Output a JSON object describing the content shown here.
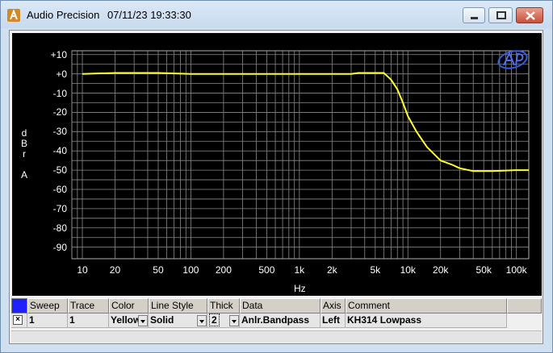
{
  "window": {
    "app_name": "Audio Precision",
    "datetime": "07/11/23 19:33:30"
  },
  "chart_data": {
    "type": "line",
    "xlabel": "Hz",
    "ylabel_letters": [
      "d",
      "B",
      "r",
      "",
      "A"
    ],
    "xscale": "log",
    "xlim": [
      8,
      130000
    ],
    "ylim": [
      -96,
      12
    ],
    "x_ticks": [
      {
        "v": 10,
        "label": "10"
      },
      {
        "v": 20,
        "label": "20"
      },
      {
        "v": 50,
        "label": "50"
      },
      {
        "v": 100,
        "label": "100"
      },
      {
        "v": 200,
        "label": "200"
      },
      {
        "v": 500,
        "label": "500"
      },
      {
        "v": 1000,
        "label": "1k"
      },
      {
        "v": 2000,
        "label": "2k"
      },
      {
        "v": 5000,
        "label": "5k"
      },
      {
        "v": 10000,
        "label": "10k"
      },
      {
        "v": 20000,
        "label": "20k"
      },
      {
        "v": 50000,
        "label": "50k"
      },
      {
        "v": 100000,
        "label": "100k"
      }
    ],
    "y_ticks": [
      {
        "v": 10,
        "label": "+10"
      },
      {
        "v": 0,
        "label": "+0"
      },
      {
        "v": -10,
        "label": "-10"
      },
      {
        "v": -20,
        "label": "-20"
      },
      {
        "v": -30,
        "label": "-30"
      },
      {
        "v": -40,
        "label": "-40"
      },
      {
        "v": -50,
        "label": "-50"
      },
      {
        "v": -60,
        "label": "-60"
      },
      {
        "v": -70,
        "label": "-70"
      },
      {
        "v": -80,
        "label": "-80"
      },
      {
        "v": -90,
        "label": "-90"
      }
    ],
    "grid": true,
    "series": [
      {
        "color": "#ffff33",
        "x": [
          10,
          20,
          50,
          100,
          200,
          500,
          1000,
          2000,
          3000,
          3500,
          5000,
          6000,
          7000,
          8000,
          9000,
          10000,
          12000,
          15000,
          20000,
          25000,
          30000,
          40000,
          50000,
          60000,
          100000,
          130000
        ],
        "y": [
          0,
          0.5,
          0.5,
          0,
          0,
          0,
          0,
          0,
          0,
          0.5,
          0.5,
          0.5,
          -3,
          -8,
          -15,
          -22,
          -30,
          -38,
          -45,
          -47,
          -49,
          -50.5,
          -50.5,
          -50.5,
          -50,
          -50
        ]
      }
    ]
  },
  "table": {
    "headers": [
      "Sweep",
      "Trace",
      "Color",
      "Line Style",
      "Thick",
      "Data",
      "Axis",
      "Comment"
    ],
    "row": {
      "checked": "×",
      "sweep": "1",
      "trace": "1",
      "color": "Yellow",
      "line_style": "Solid",
      "thick": "2",
      "data": "Anlr.Bandpass",
      "axis": "Left",
      "comment": "KH314 Lowpass"
    }
  }
}
